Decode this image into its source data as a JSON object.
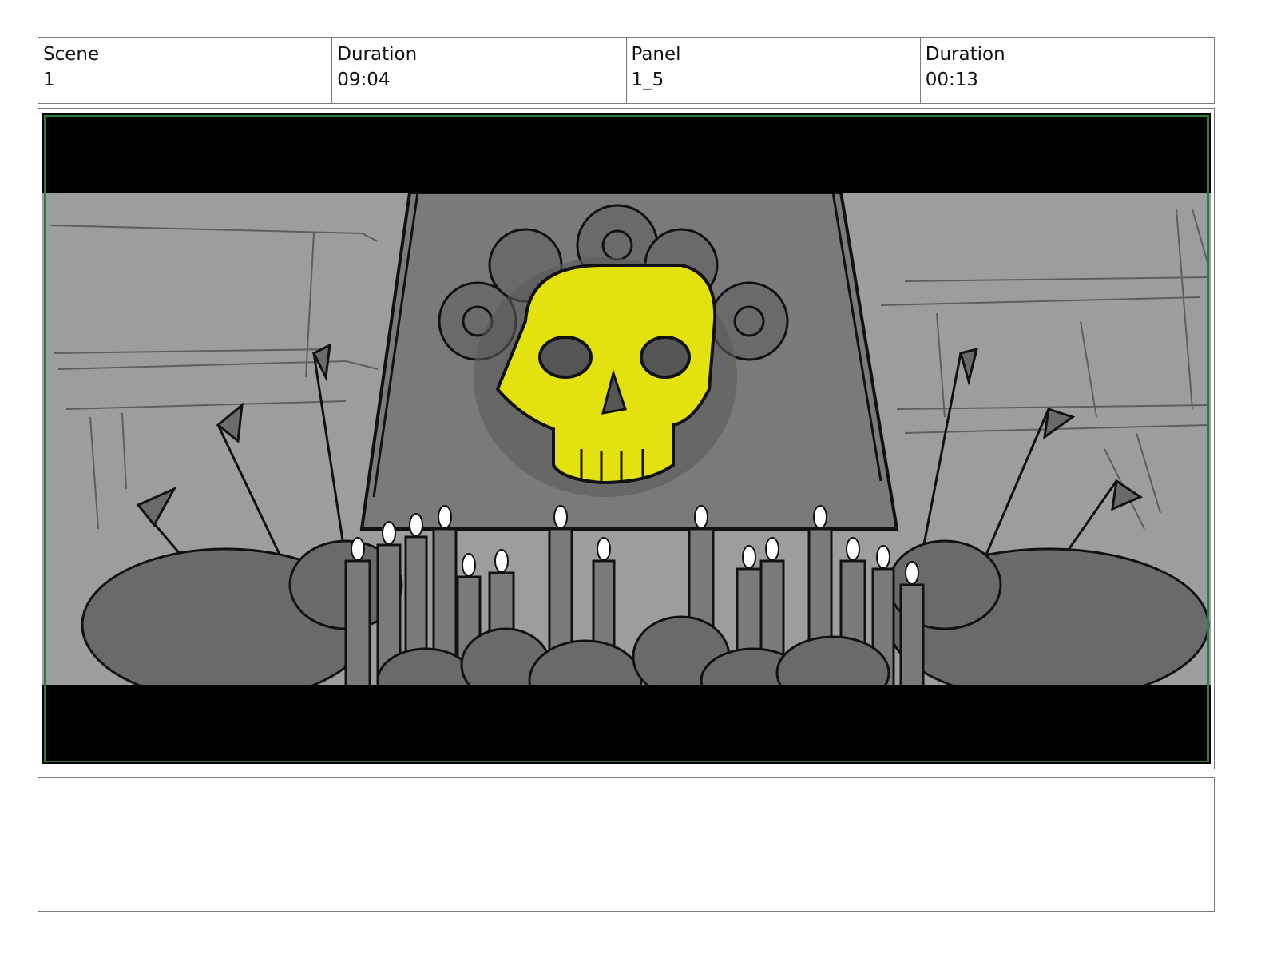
{
  "header": {
    "scene_label": "Scene",
    "scene_value": "1",
    "duration_label": "Duration",
    "duration_value": "09:04",
    "panel_label": "Panel",
    "panel_value": "1_5",
    "panel_duration_label": "Duration",
    "panel_duration_value": "00:13"
  },
  "panel": {
    "image_subject": "storyboard sketch: shrine with glowing yellow skull, candles, arrows and flowers",
    "colors": {
      "skull": "#e3e10f",
      "background": "#9d9d9d",
      "shrine": "#7a7a7a",
      "letterbox": "#000000",
      "safe_frame": "#2e7d32"
    }
  },
  "notes": {
    "text": ""
  }
}
